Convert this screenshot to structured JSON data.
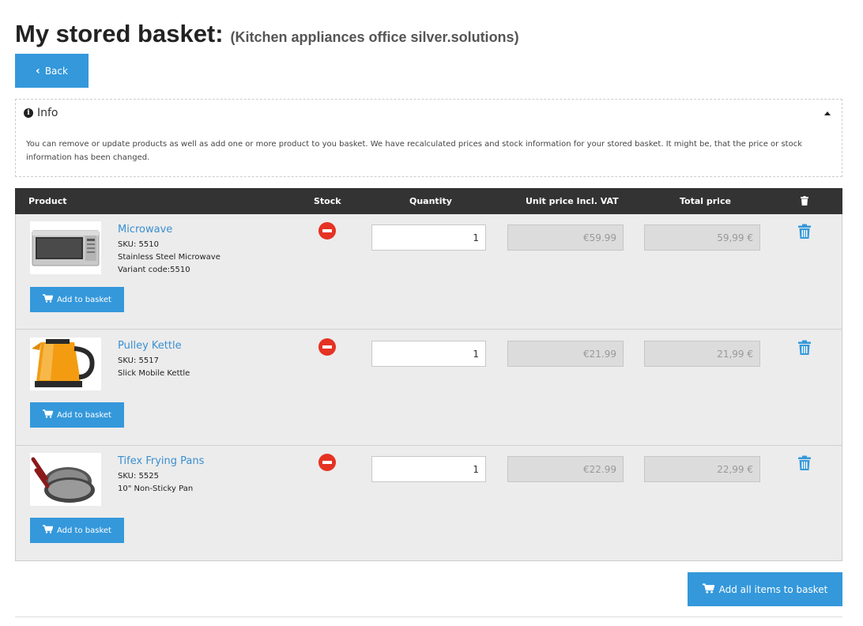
{
  "page": {
    "title": "My stored basket:",
    "subtitle": "(Kitchen appliances office silver.solutions)"
  },
  "back_button": {
    "label": "Back"
  },
  "info": {
    "heading": "Info",
    "text": "You can remove or update products as well as add one or more product to you basket. We have recalculated prices and stock information for your stored basket. It might be, that the price or stock information has been changed."
  },
  "table": {
    "headers": {
      "product": "Product",
      "stock": "Stock",
      "quantity": "Quantity",
      "unit_price": "Unit price Incl. VAT",
      "total_price": "Total price"
    },
    "rows": [
      {
        "name": "Microwave",
        "sku": "SKU: 5510",
        "desc": "Stainless Steel Microwave",
        "variant": "Variant code:5510",
        "quantity": "1",
        "unit_price": "€59.99",
        "total_price": "59,99 €",
        "add_label": "Add to basket",
        "stock_icon": "out-of-stock-icon",
        "image_icon": "microwave-image"
      },
      {
        "name": "Pulley Kettle",
        "sku": "SKU: 5517",
        "desc": "Slick Mobile Kettle",
        "variant": "",
        "quantity": "1",
        "unit_price": "€21.99",
        "total_price": "21,99 €",
        "add_label": "Add to basket",
        "stock_icon": "out-of-stock-icon",
        "image_icon": "kettle-image"
      },
      {
        "name": "Tifex Frying Pans",
        "sku": "SKU: 5525",
        "desc": "10\" Non-Sticky Pan",
        "variant": "",
        "quantity": "1",
        "unit_price": "€22.99",
        "total_price": "22,99 €",
        "add_label": "Add to basket",
        "stock_icon": "out-of-stock-icon",
        "image_icon": "frying-pans-image"
      }
    ]
  },
  "add_all_button": {
    "label": "Add all items to basket"
  },
  "colors": {
    "accent": "#3498db",
    "header_bg": "#333333",
    "stock_red": "#e53222",
    "link": "#3a8fd0",
    "row_bg": "#ececec"
  }
}
